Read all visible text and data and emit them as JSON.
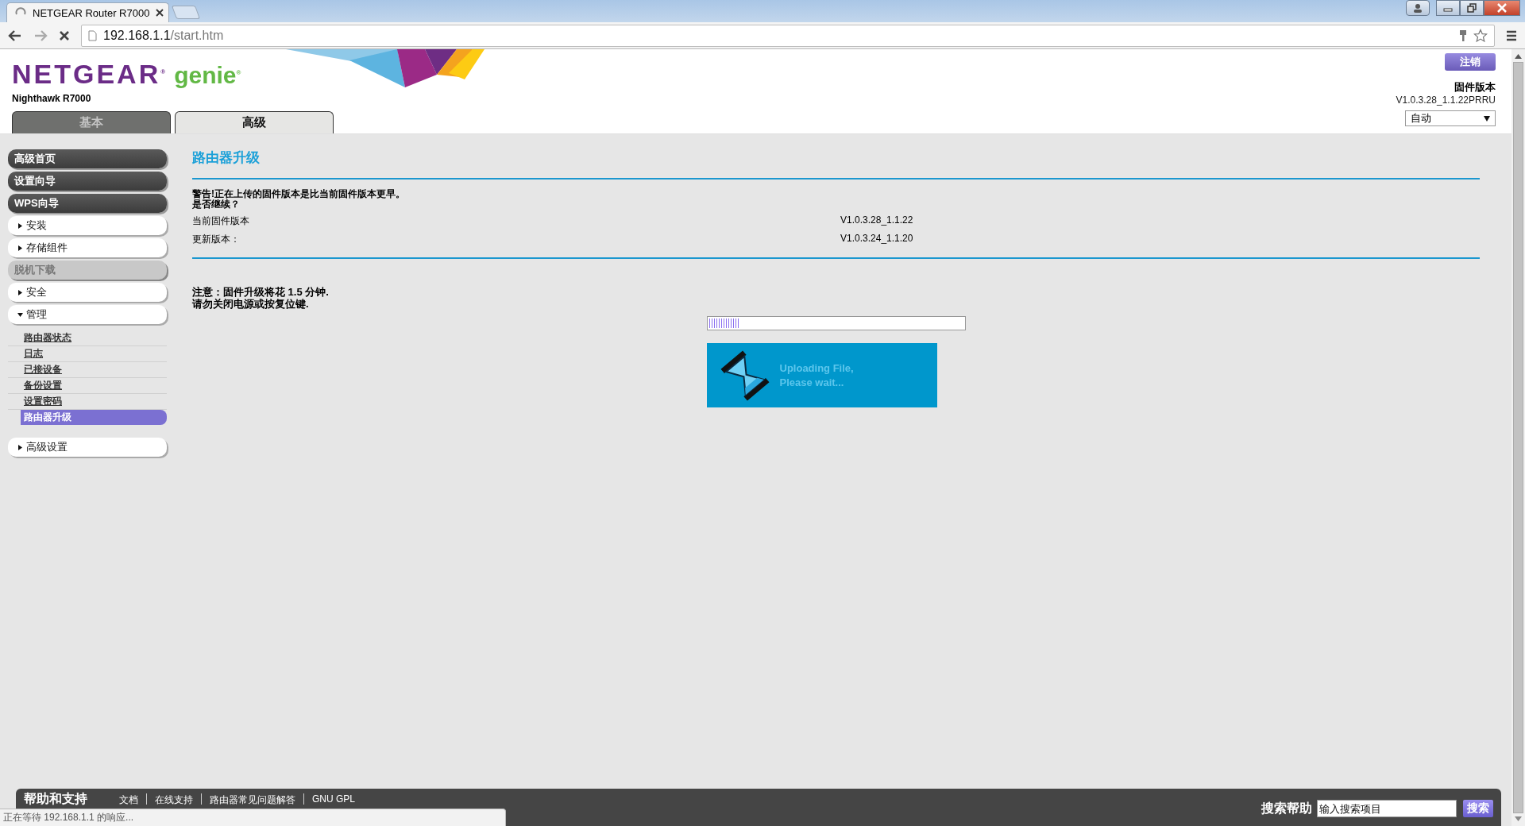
{
  "browser": {
    "tab_title": "NETGEAR Router R7000",
    "url_host": "192.168.1.1",
    "url_path": "/start.htm",
    "status": "正在等待 192.168.1.1 的响应..."
  },
  "header": {
    "brand": "NETGEAR$^{®}$",
    "product": "genie$^{®}$",
    "model": "Nighthawk R7000",
    "logout": "注销",
    "firmware_label": "固件版本",
    "firmware_version": "V1.0.3.28_1.1.22PRRU",
    "language": "自动"
  },
  "tabs": [
    {
      "label": "基本",
      "selected": false
    },
    {
      "label": "高级",
      "selected": true
    }
  ],
  "sidebar": {
    "items": [
      {
        "label": "高级首页",
        "kind": "dark"
      },
      {
        "label": "设置向导",
        "kind": "dark"
      },
      {
        "label": "WPS向导",
        "kind": "dark"
      },
      {
        "label": "安装",
        "kind": "group",
        "expanded": false
      },
      {
        "label": "存储组件",
        "kind": "group",
        "expanded": false
      },
      {
        "label": "脱机下载",
        "kind": "disabled"
      },
      {
        "label": "安全",
        "kind": "group",
        "expanded": false
      },
      {
        "label": "管理",
        "kind": "group",
        "expanded": true,
        "children": [
          {
            "label": "路由器状态",
            "selected": false
          },
          {
            "label": "日志",
            "selected": false
          },
          {
            "label": "已接设备",
            "selected": false
          },
          {
            "label": "备份设置",
            "selected": false
          },
          {
            "label": "设置密码",
            "selected": false
          },
          {
            "label": "路由器升级",
            "selected": true
          }
        ]
      },
      {
        "label": "高级设置",
        "kind": "group",
        "expanded": false
      }
    ]
  },
  "content": {
    "title": "路由器升级",
    "warning": [
      "警告!正在上传的固件版本是比当前固件版本更早。",
      "是否继续？"
    ],
    "versions": [
      {
        "label": "当前固件版本",
        "value": "V1.0.3.28_1.1.22"
      },
      {
        "label": "更新版本：",
        "value": "V1.0.3.24_1.1.20"
      }
    ],
    "notice": [
      "注意：固件升级将花 1.5 分钟.",
      "请勿关闭电源或按复位键."
    ],
    "progress": {
      "level": 0.12
    },
    "upload": [
      "Uploading File,",
      "Please wait..."
    ]
  },
  "footer": {
    "title": "帮助和支持",
    "links": [
      "文档",
      "在线支持",
      "路由器常见问题解答",
      "GNU GPL"
    ],
    "search_label": "搜索帮助",
    "search_placeholder": "输入搜索项目",
    "search_button": "搜索"
  }
}
